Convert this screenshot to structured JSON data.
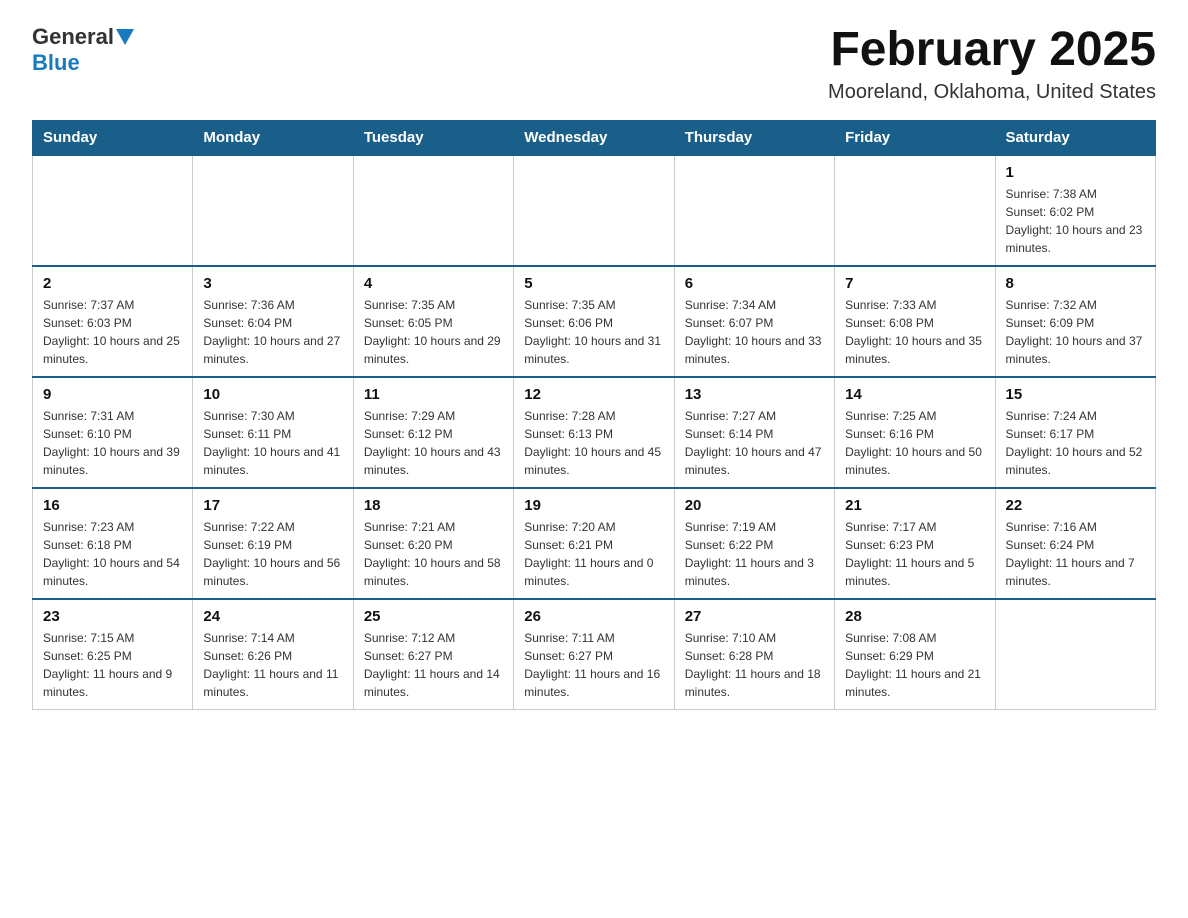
{
  "header": {
    "logo_general": "General",
    "logo_blue": "Blue",
    "month_title": "February 2025",
    "location": "Mooreland, Oklahoma, United States"
  },
  "days_of_week": [
    "Sunday",
    "Monday",
    "Tuesday",
    "Wednesday",
    "Thursday",
    "Friday",
    "Saturday"
  ],
  "weeks": [
    [
      {
        "day": "",
        "info": ""
      },
      {
        "day": "",
        "info": ""
      },
      {
        "day": "",
        "info": ""
      },
      {
        "day": "",
        "info": ""
      },
      {
        "day": "",
        "info": ""
      },
      {
        "day": "",
        "info": ""
      },
      {
        "day": "1",
        "info": "Sunrise: 7:38 AM\nSunset: 6:02 PM\nDaylight: 10 hours and 23 minutes."
      }
    ],
    [
      {
        "day": "2",
        "info": "Sunrise: 7:37 AM\nSunset: 6:03 PM\nDaylight: 10 hours and 25 minutes."
      },
      {
        "day": "3",
        "info": "Sunrise: 7:36 AM\nSunset: 6:04 PM\nDaylight: 10 hours and 27 minutes."
      },
      {
        "day": "4",
        "info": "Sunrise: 7:35 AM\nSunset: 6:05 PM\nDaylight: 10 hours and 29 minutes."
      },
      {
        "day": "5",
        "info": "Sunrise: 7:35 AM\nSunset: 6:06 PM\nDaylight: 10 hours and 31 minutes."
      },
      {
        "day": "6",
        "info": "Sunrise: 7:34 AM\nSunset: 6:07 PM\nDaylight: 10 hours and 33 minutes."
      },
      {
        "day": "7",
        "info": "Sunrise: 7:33 AM\nSunset: 6:08 PM\nDaylight: 10 hours and 35 minutes."
      },
      {
        "day": "8",
        "info": "Sunrise: 7:32 AM\nSunset: 6:09 PM\nDaylight: 10 hours and 37 minutes."
      }
    ],
    [
      {
        "day": "9",
        "info": "Sunrise: 7:31 AM\nSunset: 6:10 PM\nDaylight: 10 hours and 39 minutes."
      },
      {
        "day": "10",
        "info": "Sunrise: 7:30 AM\nSunset: 6:11 PM\nDaylight: 10 hours and 41 minutes."
      },
      {
        "day": "11",
        "info": "Sunrise: 7:29 AM\nSunset: 6:12 PM\nDaylight: 10 hours and 43 minutes."
      },
      {
        "day": "12",
        "info": "Sunrise: 7:28 AM\nSunset: 6:13 PM\nDaylight: 10 hours and 45 minutes."
      },
      {
        "day": "13",
        "info": "Sunrise: 7:27 AM\nSunset: 6:14 PM\nDaylight: 10 hours and 47 minutes."
      },
      {
        "day": "14",
        "info": "Sunrise: 7:25 AM\nSunset: 6:16 PM\nDaylight: 10 hours and 50 minutes."
      },
      {
        "day": "15",
        "info": "Sunrise: 7:24 AM\nSunset: 6:17 PM\nDaylight: 10 hours and 52 minutes."
      }
    ],
    [
      {
        "day": "16",
        "info": "Sunrise: 7:23 AM\nSunset: 6:18 PM\nDaylight: 10 hours and 54 minutes."
      },
      {
        "day": "17",
        "info": "Sunrise: 7:22 AM\nSunset: 6:19 PM\nDaylight: 10 hours and 56 minutes."
      },
      {
        "day": "18",
        "info": "Sunrise: 7:21 AM\nSunset: 6:20 PM\nDaylight: 10 hours and 58 minutes."
      },
      {
        "day": "19",
        "info": "Sunrise: 7:20 AM\nSunset: 6:21 PM\nDaylight: 11 hours and 0 minutes."
      },
      {
        "day": "20",
        "info": "Sunrise: 7:19 AM\nSunset: 6:22 PM\nDaylight: 11 hours and 3 minutes."
      },
      {
        "day": "21",
        "info": "Sunrise: 7:17 AM\nSunset: 6:23 PM\nDaylight: 11 hours and 5 minutes."
      },
      {
        "day": "22",
        "info": "Sunrise: 7:16 AM\nSunset: 6:24 PM\nDaylight: 11 hours and 7 minutes."
      }
    ],
    [
      {
        "day": "23",
        "info": "Sunrise: 7:15 AM\nSunset: 6:25 PM\nDaylight: 11 hours and 9 minutes."
      },
      {
        "day": "24",
        "info": "Sunrise: 7:14 AM\nSunset: 6:26 PM\nDaylight: 11 hours and 11 minutes."
      },
      {
        "day": "25",
        "info": "Sunrise: 7:12 AM\nSunset: 6:27 PM\nDaylight: 11 hours and 14 minutes."
      },
      {
        "day": "26",
        "info": "Sunrise: 7:11 AM\nSunset: 6:27 PM\nDaylight: 11 hours and 16 minutes."
      },
      {
        "day": "27",
        "info": "Sunrise: 7:10 AM\nSunset: 6:28 PM\nDaylight: 11 hours and 18 minutes."
      },
      {
        "day": "28",
        "info": "Sunrise: 7:08 AM\nSunset: 6:29 PM\nDaylight: 11 hours and 21 minutes."
      },
      {
        "day": "",
        "info": ""
      }
    ]
  ]
}
